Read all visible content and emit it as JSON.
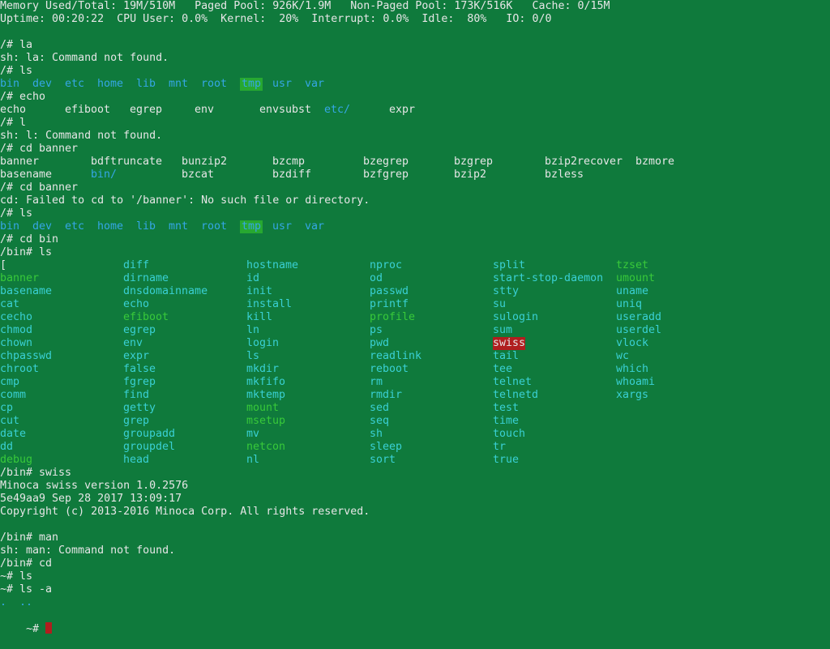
{
  "colors": {
    "background": "#0f7a3c",
    "default": "#e6e6e6",
    "dir": "#35a7e6",
    "file": "#3ad0d4",
    "exec": "#38c93a",
    "highlight_dir_bg": "#27a831",
    "highlight_exec_bg": "#b01e1e",
    "cursor": "#b01e1e"
  },
  "status": {
    "line1": "Memory Used/Total: 19M/510M   Paged Pool: 926K/1.9M   Non-Paged Pool: 173K/516K   Cache: 0/15M",
    "line2": "Uptime: 00:20:22  CPU User: 0.0%  Kernel:  20%  Interrupt: 0.0%  Idle:  80%   IO: 0/0"
  },
  "lines": [
    {
      "row": 3,
      "text": "/# la"
    },
    {
      "row": 4,
      "text": "sh: la: Command not found."
    },
    {
      "row": 5,
      "text": "/# ls"
    },
    {
      "row": 6,
      "tokens": [
        {
          "col": 0,
          "text": "bin",
          "color": "dir"
        },
        {
          "col": 5,
          "text": "dev",
          "color": "dir"
        },
        {
          "col": 10,
          "text": "etc",
          "color": "dir"
        },
        {
          "col": 15,
          "text": "home",
          "color": "dir"
        },
        {
          "col": 21,
          "text": "lib",
          "color": "dir"
        },
        {
          "col": 26,
          "text": "mnt",
          "color": "dir"
        },
        {
          "col": 31,
          "text": "root",
          "color": "dir"
        },
        {
          "col": 37,
          "text": "tmp",
          "color": "dir",
          "hl": "green"
        },
        {
          "col": 42,
          "text": "usr",
          "color": "dir"
        },
        {
          "col": 47,
          "text": "var",
          "color": "dir"
        }
      ]
    },
    {
      "row": 7,
      "text": "/# echo"
    },
    {
      "row": 8,
      "tokens": [
        {
          "col": 0,
          "text": "echo"
        },
        {
          "col": 10,
          "text": "efiboot"
        },
        {
          "col": 20,
          "text": "egrep"
        },
        {
          "col": 30,
          "text": "env"
        },
        {
          "col": 40,
          "text": "envsubst"
        },
        {
          "col": 50,
          "text": "etc/",
          "color": "dir"
        },
        {
          "col": 60,
          "text": "expr"
        }
      ]
    },
    {
      "row": 9,
      "text": "/# l"
    },
    {
      "row": 10,
      "text": "sh: l: Command not found."
    },
    {
      "row": 11,
      "text": "/# cd banner"
    },
    {
      "row": 12,
      "tokens": [
        {
          "col": 0,
          "text": "banner"
        },
        {
          "col": 14,
          "text": "bdftruncate"
        },
        {
          "col": 28,
          "text": "bunzip2"
        },
        {
          "col": 42,
          "text": "bzcmp"
        },
        {
          "col": 56,
          "text": "bzegrep"
        },
        {
          "col": 70,
          "text": "bzgrep"
        },
        {
          "col": 84,
          "text": "bzip2recover"
        },
        {
          "col": 98,
          "text": "bzmore"
        }
      ]
    },
    {
      "row": 13,
      "tokens": [
        {
          "col": 0,
          "text": "basename"
        },
        {
          "col": 14,
          "text": "bin/",
          "color": "dir"
        },
        {
          "col": 28,
          "text": "bzcat"
        },
        {
          "col": 42,
          "text": "bzdiff"
        },
        {
          "col": 56,
          "text": "bzfgrep"
        },
        {
          "col": 70,
          "text": "bzip2"
        },
        {
          "col": 84,
          "text": "bzless"
        }
      ]
    },
    {
      "row": 14,
      "text": "/# cd banner"
    },
    {
      "row": 15,
      "text": "cd: Failed to cd to '/banner': No such file or directory."
    },
    {
      "row": 16,
      "text": "/# ls"
    },
    {
      "row": 17,
      "tokens": [
        {
          "col": 0,
          "text": "bin",
          "color": "dir"
        },
        {
          "col": 5,
          "text": "dev",
          "color": "dir"
        },
        {
          "col": 10,
          "text": "etc",
          "color": "dir"
        },
        {
          "col": 15,
          "text": "home",
          "color": "dir"
        },
        {
          "col": 21,
          "text": "lib",
          "color": "dir"
        },
        {
          "col": 26,
          "text": "mnt",
          "color": "dir"
        },
        {
          "col": 31,
          "text": "root",
          "color": "dir"
        },
        {
          "col": 37,
          "text": "tmp",
          "color": "dir",
          "hl": "green"
        },
        {
          "col": 42,
          "text": "usr",
          "color": "dir"
        },
        {
          "col": 47,
          "text": "var",
          "color": "dir"
        }
      ]
    },
    {
      "row": 18,
      "text": "/# cd bin"
    },
    {
      "row": 19,
      "text": "/bin# ls"
    },
    {
      "row": 20,
      "tokens": [
        {
          "col": 0,
          "text": "["
        },
        {
          "col": 19,
          "text": "diff",
          "color": "file"
        },
        {
          "col": 38,
          "text": "hostname",
          "color": "file"
        },
        {
          "col": 57,
          "text": "nproc",
          "color": "file"
        },
        {
          "col": 76,
          "text": "split",
          "color": "file"
        },
        {
          "col": 95,
          "text": "tzset",
          "color": "exec"
        }
      ]
    },
    {
      "row": 21,
      "tokens": [
        {
          "col": 0,
          "text": "banner",
          "color": "exec"
        },
        {
          "col": 19,
          "text": "dirname",
          "color": "file"
        },
        {
          "col": 38,
          "text": "id",
          "color": "file"
        },
        {
          "col": 57,
          "text": "od",
          "color": "file"
        },
        {
          "col": 76,
          "text": "start-stop-daemon",
          "color": "file"
        },
        {
          "col": 95,
          "text": "umount",
          "color": "exec"
        }
      ]
    },
    {
      "row": 22,
      "tokens": [
        {
          "col": 0,
          "text": "basename",
          "color": "file"
        },
        {
          "col": 19,
          "text": "dnsdomainname",
          "color": "file"
        },
        {
          "col": 38,
          "text": "init",
          "color": "file"
        },
        {
          "col": 57,
          "text": "passwd",
          "color": "file"
        },
        {
          "col": 76,
          "text": "stty",
          "color": "file"
        },
        {
          "col": 95,
          "text": "uname",
          "color": "file"
        }
      ]
    },
    {
      "row": 23,
      "tokens": [
        {
          "col": 0,
          "text": "cat",
          "color": "file"
        },
        {
          "col": 19,
          "text": "echo",
          "color": "file"
        },
        {
          "col": 38,
          "text": "install",
          "color": "file"
        },
        {
          "col": 57,
          "text": "printf",
          "color": "file"
        },
        {
          "col": 76,
          "text": "su",
          "color": "file"
        },
        {
          "col": 95,
          "text": "uniq",
          "color": "file"
        }
      ]
    },
    {
      "row": 24,
      "tokens": [
        {
          "col": 0,
          "text": "cecho",
          "color": "file"
        },
        {
          "col": 19,
          "text": "efiboot",
          "color": "exec"
        },
        {
          "col": 38,
          "text": "kill",
          "color": "file"
        },
        {
          "col": 57,
          "text": "profile",
          "color": "exec"
        },
        {
          "col": 76,
          "text": "sulogin",
          "color": "file"
        },
        {
          "col": 95,
          "text": "useradd",
          "color": "file"
        }
      ]
    },
    {
      "row": 25,
      "tokens": [
        {
          "col": 0,
          "text": "chmod",
          "color": "file"
        },
        {
          "col": 19,
          "text": "egrep",
          "color": "file"
        },
        {
          "col": 38,
          "text": "ln",
          "color": "file"
        },
        {
          "col": 57,
          "text": "ps",
          "color": "file"
        },
        {
          "col": 76,
          "text": "sum",
          "color": "file"
        },
        {
          "col": 95,
          "text": "userdel",
          "color": "file"
        }
      ]
    },
    {
      "row": 26,
      "tokens": [
        {
          "col": 0,
          "text": "chown",
          "color": "file"
        },
        {
          "col": 19,
          "text": "env",
          "color": "file"
        },
        {
          "col": 38,
          "text": "login",
          "color": "file"
        },
        {
          "col": 57,
          "text": "pwd",
          "color": "file"
        },
        {
          "col": 76,
          "text": "swiss",
          "color": "default",
          "hl": "red"
        },
        {
          "col": 95,
          "text": "vlock",
          "color": "file"
        }
      ]
    },
    {
      "row": 27,
      "tokens": [
        {
          "col": 0,
          "text": "chpasswd",
          "color": "file"
        },
        {
          "col": 19,
          "text": "expr",
          "color": "file"
        },
        {
          "col": 38,
          "text": "ls",
          "color": "file"
        },
        {
          "col": 57,
          "text": "readlink",
          "color": "file"
        },
        {
          "col": 76,
          "text": "tail",
          "color": "file"
        },
        {
          "col": 95,
          "text": "wc",
          "color": "file"
        }
      ]
    },
    {
      "row": 28,
      "tokens": [
        {
          "col": 0,
          "text": "chroot",
          "color": "file"
        },
        {
          "col": 19,
          "text": "false",
          "color": "file"
        },
        {
          "col": 38,
          "text": "mkdir",
          "color": "file"
        },
        {
          "col": 57,
          "text": "reboot",
          "color": "file"
        },
        {
          "col": 76,
          "text": "tee",
          "color": "file"
        },
        {
          "col": 95,
          "text": "which",
          "color": "file"
        }
      ]
    },
    {
      "row": 29,
      "tokens": [
        {
          "col": 0,
          "text": "cmp",
          "color": "file"
        },
        {
          "col": 19,
          "text": "fgrep",
          "color": "file"
        },
        {
          "col": 38,
          "text": "mkfifo",
          "color": "file"
        },
        {
          "col": 57,
          "text": "rm",
          "color": "file"
        },
        {
          "col": 76,
          "text": "telnet",
          "color": "file"
        },
        {
          "col": 95,
          "text": "whoami",
          "color": "file"
        }
      ]
    },
    {
      "row": 30,
      "tokens": [
        {
          "col": 0,
          "text": "comm",
          "color": "file"
        },
        {
          "col": 19,
          "text": "find",
          "color": "file"
        },
        {
          "col": 38,
          "text": "mktemp",
          "color": "file"
        },
        {
          "col": 57,
          "text": "rmdir",
          "color": "file"
        },
        {
          "col": 76,
          "text": "telnetd",
          "color": "file"
        },
        {
          "col": 95,
          "text": "xargs",
          "color": "file"
        }
      ]
    },
    {
      "row": 31,
      "tokens": [
        {
          "col": 0,
          "text": "cp",
          "color": "file"
        },
        {
          "col": 19,
          "text": "getty",
          "color": "file"
        },
        {
          "col": 38,
          "text": "mount",
          "color": "exec"
        },
        {
          "col": 57,
          "text": "sed",
          "color": "file"
        },
        {
          "col": 76,
          "text": "test",
          "color": "file"
        }
      ]
    },
    {
      "row": 32,
      "tokens": [
        {
          "col": 0,
          "text": "cut",
          "color": "file"
        },
        {
          "col": 19,
          "text": "grep",
          "color": "file"
        },
        {
          "col": 38,
          "text": "msetup",
          "color": "exec"
        },
        {
          "col": 57,
          "text": "seq",
          "color": "file"
        },
        {
          "col": 76,
          "text": "time",
          "color": "file"
        }
      ]
    },
    {
      "row": 33,
      "tokens": [
        {
          "col": 0,
          "text": "date",
          "color": "file"
        },
        {
          "col": 19,
          "text": "groupadd",
          "color": "file"
        },
        {
          "col": 38,
          "text": "mv",
          "color": "file"
        },
        {
          "col": 57,
          "text": "sh",
          "color": "file"
        },
        {
          "col": 76,
          "text": "touch",
          "color": "file"
        }
      ]
    },
    {
      "row": 34,
      "tokens": [
        {
          "col": 0,
          "text": "dd",
          "color": "file"
        },
        {
          "col": 19,
          "text": "groupdel",
          "color": "file"
        },
        {
          "col": 38,
          "text": "netcon",
          "color": "exec"
        },
        {
          "col": 57,
          "text": "sleep",
          "color": "file"
        },
        {
          "col": 76,
          "text": "tr",
          "color": "file"
        }
      ]
    },
    {
      "row": 35,
      "tokens": [
        {
          "col": 0,
          "text": "debug",
          "color": "exec"
        },
        {
          "col": 19,
          "text": "head",
          "color": "file"
        },
        {
          "col": 38,
          "text": "nl",
          "color": "file"
        },
        {
          "col": 57,
          "text": "sort",
          "color": "file"
        },
        {
          "col": 76,
          "text": "true",
          "color": "file"
        }
      ]
    },
    {
      "row": 36,
      "text": "/bin# swiss"
    },
    {
      "row": 37,
      "text": "Minoca swiss version 1.0.2576"
    },
    {
      "row": 38,
      "text": "5e49aa9 Sep 28 2017 13:09:17"
    },
    {
      "row": 39,
      "text": "Copyright (c) 2013-2016 Minoca Corp. All rights reserved."
    },
    {
      "row": 41,
      "text": "/bin# man"
    },
    {
      "row": 42,
      "text": "sh: man: Command not found."
    },
    {
      "row": 43,
      "text": "/bin# cd"
    },
    {
      "row": 44,
      "text": "~# ls"
    },
    {
      "row": 45,
      "text": "~# ls -a"
    },
    {
      "row": 46,
      "tokens": [
        {
          "col": 0,
          "text": ".",
          "color": "dir"
        },
        {
          "col": 3,
          "text": "..",
          "color": "dir"
        }
      ]
    }
  ],
  "prompt": {
    "row": 47,
    "text": "~# "
  }
}
